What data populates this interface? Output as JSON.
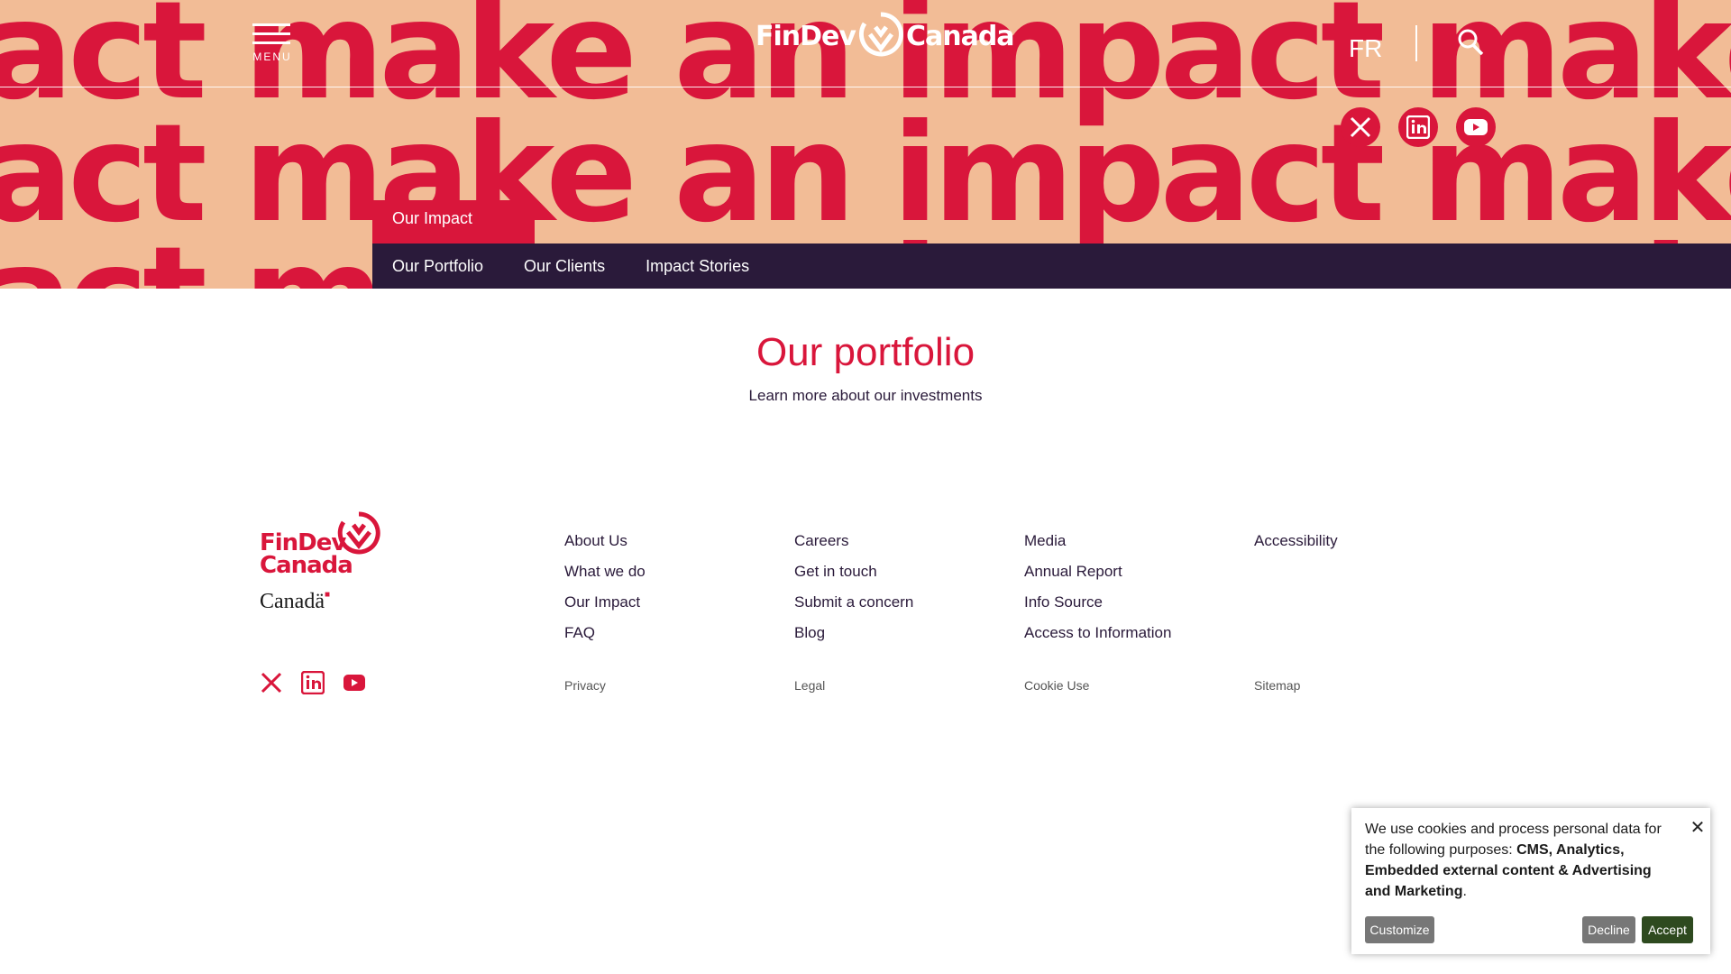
{
  "hero": {
    "bg_text": "act make an impact make an impact make an impact make",
    "menu_label": "MENU",
    "logo_left": "FinDev",
    "logo_right": "Canada",
    "lang": "FR"
  },
  "breadcrumb": "Our Impact",
  "subnav": [
    "Our Portfolio",
    "Our Clients",
    "Impact Stories"
  ],
  "main": {
    "title": "Our portfolio",
    "subtitle": "Learn more about our investments"
  },
  "footer": {
    "logo_line1": "FinDev",
    "logo_line2": "Canada",
    "canada_word": "Canadä",
    "columns": [
      [
        "About Us",
        "What we do",
        "Our Impact",
        "FAQ"
      ],
      [
        "Careers",
        "Get in touch",
        "Submit a concern",
        "Blog"
      ],
      [
        "Media",
        "Annual Report",
        "Info Source",
        "Access to Information"
      ],
      [
        "Accessibility"
      ]
    ],
    "small_links": [
      "Privacy",
      "Legal",
      "Cookie Use",
      "Sitemap"
    ]
  },
  "cookie": {
    "text_plain": "We use cookies and process personal data for the following purposes: ",
    "text_bold": "CMS, Analytics, Embedded external content & Advertising and Marketing",
    "text_end": ".",
    "customize": "Customize",
    "decline": "Decline",
    "accept": "Accept"
  },
  "colors": {
    "brand_red": "#d9163b",
    "hero_bg": "#f2bc96",
    "dark_nav": "#2a1a3a",
    "accept_green": "#2e4a1f"
  },
  "icons": [
    "menu-icon",
    "search-icon",
    "x-twitter-icon",
    "linkedin-icon",
    "youtube-icon",
    "close-icon"
  ]
}
